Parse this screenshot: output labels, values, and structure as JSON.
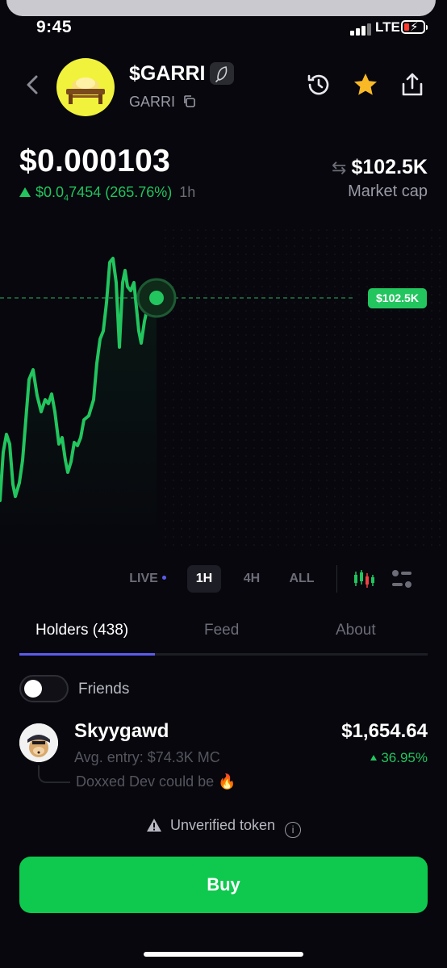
{
  "status_bar": {
    "time": "9:45",
    "network": "LTE"
  },
  "token": {
    "ticker": "$GARRI",
    "name": "GARRI"
  },
  "price": {
    "value": "$0.000103",
    "change_prefix": "$0.0",
    "change_sub": "4",
    "change_rest": "7454 (265.76%)",
    "period": "1h"
  },
  "market_cap": {
    "value": "$102.5K",
    "label": "Market cap"
  },
  "chart_tag": "$102.5K",
  "ranges": {
    "live": "LIVE",
    "h1": "1H",
    "h4": "4H",
    "all": "ALL",
    "active": "1H"
  },
  "tabs": {
    "holders": "Holders (438)",
    "feed": "Feed",
    "about": "About"
  },
  "friends": {
    "label": "Friends",
    "enabled": false
  },
  "holder": {
    "name": "Skyygawd",
    "entry": "Avg. entry: $74.3K MC",
    "value": "$1,654.64",
    "change": "36.95%",
    "comment": "Doxxed Dev could be 🔥"
  },
  "warning": "Unverified token",
  "buy_label": "Buy",
  "colors": {
    "accent_green": "#22c55e",
    "buy_green": "#0ec94e",
    "tab_indicator": "#5b5bf0",
    "background": "#07070d"
  }
}
